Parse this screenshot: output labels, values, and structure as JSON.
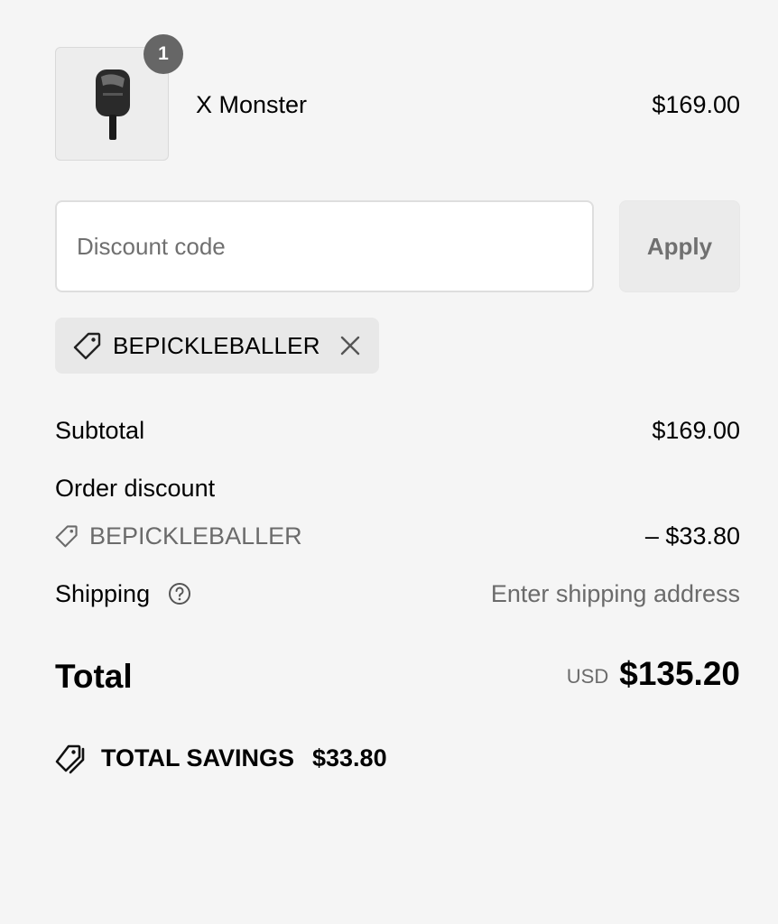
{
  "line_item": {
    "quantity": "1",
    "name": "X Monster",
    "price": "$169.00",
    "thumbnail_icon": "pickleball-paddle-image"
  },
  "discount": {
    "placeholder": "Discount code",
    "value": "",
    "apply_label": "Apply",
    "applied_code": "BEPICKLEBALLER"
  },
  "summary": {
    "subtotal_label": "Subtotal",
    "subtotal_value": "$169.00",
    "order_discount_label": "Order discount",
    "order_discount_code": "BEPICKLEBALLER",
    "order_discount_value": "– $33.80",
    "shipping_label": "Shipping",
    "shipping_value": "Enter shipping address",
    "total_label": "Total",
    "currency": "USD",
    "total_value": "$135.20",
    "savings_label": "TOTAL SAVINGS",
    "savings_value": "$33.80"
  },
  "colors": {
    "background": "#f5f5f5",
    "badge": "#666666",
    "muted_text": "#6b6b6b"
  }
}
